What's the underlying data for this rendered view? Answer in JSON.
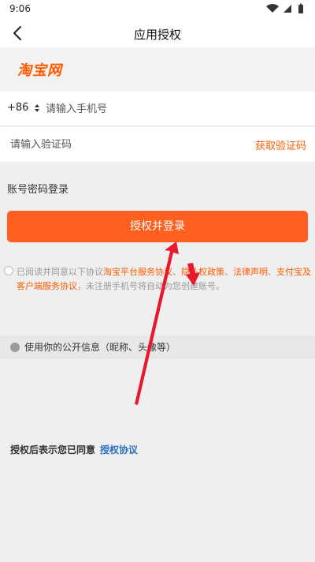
{
  "status_bar": {
    "time": "9:06",
    "icons": [
      "wifi-icon",
      "signal-icon",
      "battery-icon"
    ]
  },
  "app_bar": {
    "title": "应用授权",
    "back_icon": "chevron-left-icon"
  },
  "brand": {
    "logo_text": "淘宝网",
    "accent_color": "#ff5a00"
  },
  "phone": {
    "country_code": "+86",
    "placeholder": "请输入手机号",
    "value": ""
  },
  "code": {
    "placeholder": "请输入验证码",
    "value": "",
    "get_code_label": "获取验证码"
  },
  "password_login_label": "账号密码登录",
  "authorize_button_label": "授权并登录",
  "agreement": {
    "prefix": "已阅读并同意以下协议",
    "links": [
      "淘宝平台服务协议",
      "隐私权政策",
      "法律声明",
      "支付宝及客户端服务协议"
    ],
    "separator": "、",
    "suffix": "，未注册手机号将自动为您创建账号。"
  },
  "public_info_label": "使用你的公开信息（昵称、头像等）",
  "footer": {
    "text": "授权后表示您已同意",
    "link": "授权协议"
  }
}
